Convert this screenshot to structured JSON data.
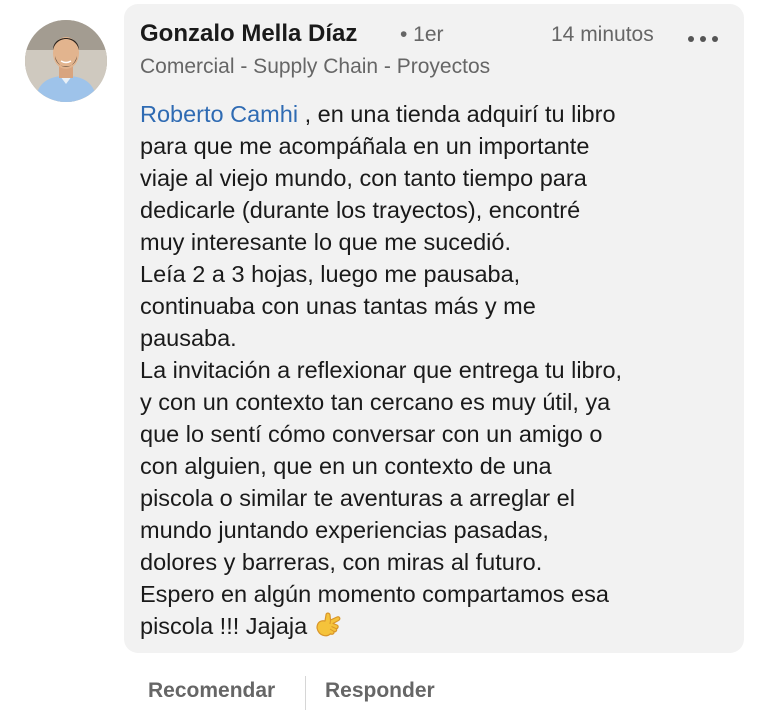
{
  "comment": {
    "author_name": "Gonzalo Mella Díaz",
    "connection_degree": "• 1er",
    "timestamp": "14 minutos",
    "more_icon": "more-horizontal-icon",
    "headline": "Comercial - Supply Chain - Proyectos",
    "mention": "Roberto Camhi",
    "body_lines": [
      " , en una tienda adquirí tu libro",
      "para que me acompáñala en un importante",
      "viaje al viejo mundo, con tanto tiempo para",
      "dedicarle (durante los trayectos), encontré",
      "muy interesante lo que me sucedió.",
      "Leía 2 a 3 hojas, luego me pausaba,",
      "continuaba con unas tantas más y me",
      "pausaba.",
      "La invitación a reflexionar que entrega tu libro,",
      "y con un contexto tan cercano es muy útil, ya",
      "que lo sentí cómo conversar con un amigo o",
      "con alguien, que en un contexto de una",
      "piscola o similar te aventuras a arreglar el",
      "mundo juntando experiencias pasadas,",
      "dolores y barreras, con miras al futuro.",
      "Espero en algún momento compartamos esa",
      "piscola !!! Jajaja"
    ],
    "emoji": "call-me-hand-emoji"
  },
  "actions": {
    "recommend_label": "Recomendar",
    "reply_label": "Responder"
  },
  "colors": {
    "bubble_background": "#f2f2f2",
    "mention_link": "#2f6bb3",
    "primary_text": "#1a1a1a",
    "secondary_text": "#666666"
  }
}
